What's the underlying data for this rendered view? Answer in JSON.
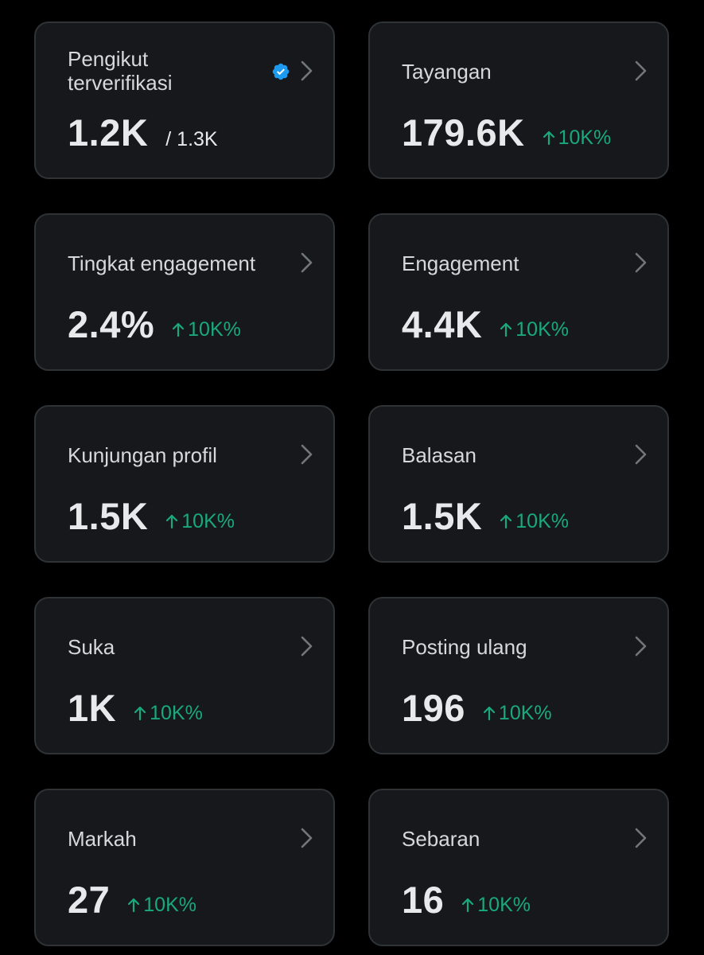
{
  "colors": {
    "background": "#000000",
    "card": "#16181c",
    "border": "#2f3336",
    "text_primary": "#e7e9ea",
    "text_label": "#d6d9db",
    "positive": "#19a97b",
    "verified": "#1d9bf0",
    "chevron": "#71767b"
  },
  "icons": {
    "chevron": "chevron-right-icon",
    "verified": "verified-badge-icon",
    "trend": "arrow-up-icon"
  },
  "cards": [
    {
      "label": "Pengikut terverifikasi",
      "value": "1.2K",
      "secondary": "/ 1.3K",
      "change": ""
    },
    {
      "label": "Tayangan",
      "value": "179.6K",
      "secondary": "",
      "change": "10K%"
    },
    {
      "label": "Tingkat engagement",
      "value": "2.4%",
      "secondary": "",
      "change": "10K%"
    },
    {
      "label": "Engagement",
      "value": "4.4K",
      "secondary": "",
      "change": "10K%"
    },
    {
      "label": "Kunjungan profil",
      "value": "1.5K",
      "secondary": "",
      "change": "10K%"
    },
    {
      "label": "Balasan",
      "value": "1.5K",
      "secondary": "",
      "change": "10K%"
    },
    {
      "label": "Suka",
      "value": "1K",
      "secondary": "",
      "change": "10K%"
    },
    {
      "label": "Posting ulang",
      "value": "196",
      "secondary": "",
      "change": "10K%"
    },
    {
      "label": "Markah",
      "value": "27",
      "secondary": "",
      "change": "10K%"
    },
    {
      "label": "Sebaran",
      "value": "16",
      "secondary": "",
      "change": "10K%"
    }
  ]
}
